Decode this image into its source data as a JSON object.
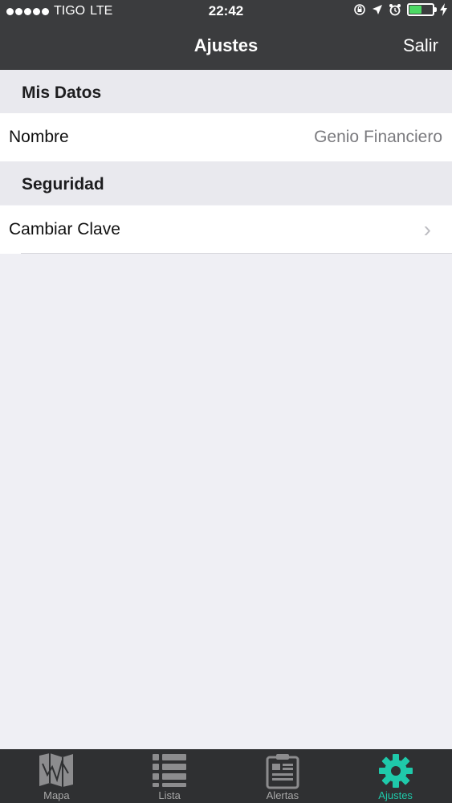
{
  "status": {
    "carrier": "TIGO",
    "network": "LTE",
    "time": "22:42",
    "battery_color": "#4cd964"
  },
  "nav": {
    "title": "Ajustes",
    "action": "Salir"
  },
  "sections": [
    {
      "header": "Mis Datos",
      "row_label": "Nombre",
      "row_value": "Genio Financiero"
    },
    {
      "header": "Seguridad",
      "row_label": "Cambiar Clave"
    }
  ],
  "tabs": [
    {
      "label": "Mapa",
      "icon": "map-icon"
    },
    {
      "label": "Lista",
      "icon": "list-icon"
    },
    {
      "label": "Alertas",
      "icon": "alert-document-icon"
    },
    {
      "label": "Ajustes",
      "icon": "gear-icon",
      "active": true
    }
  ],
  "colors": {
    "accent": "#1fc9aa",
    "bar": "#3b3c3e",
    "background": "#efeff4"
  }
}
